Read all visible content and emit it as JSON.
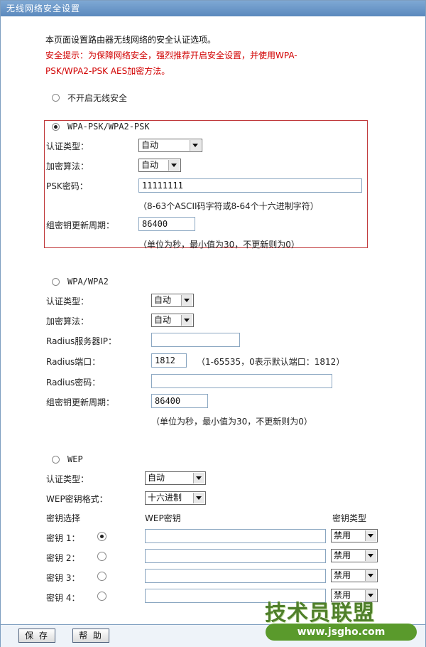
{
  "window": {
    "title": "无线网络安全设置"
  },
  "intro": {
    "line1": "本页面设置路由器无线网络的安全认证选项。",
    "warn_line1": "安全提示：为保障网络安全，强烈推荐开启安全设置，并使用WPA-",
    "warn_line2": "PSK/WPA2-PSK AES加密方法。"
  },
  "no_security": {
    "label": "不开启无线安全",
    "checked": false
  },
  "wpa_psk": {
    "label": "WPA-PSK/WPA2-PSK",
    "checked": true,
    "auth_type_label": "认证类型：",
    "auth_type_value": "自动",
    "encryption_label": "加密算法：",
    "encryption_value": "自动",
    "psk_label": "PSK密码：",
    "psk_value": "11111111",
    "psk_hint": "（8-63个ASCII码字符或8-64个十六进制字符）",
    "group_key_label": "组密钥更新周期：",
    "group_key_value": "86400",
    "group_key_hint": "（单位为秒，最小值为30，不更新则为0）"
  },
  "wpa": {
    "label": "WPA/WPA2",
    "checked": false,
    "auth_type_label": "认证类型：",
    "auth_type_value": "自动",
    "encryption_label": "加密算法：",
    "encryption_value": "自动",
    "radius_ip_label": "Radius服务器IP：",
    "radius_ip_value": "",
    "radius_port_label": "Radius端口：",
    "radius_port_value": "1812",
    "radius_port_hint": "（1-65535，0表示默认端口：1812）",
    "radius_pwd_label": "Radius密码：",
    "radius_pwd_value": "",
    "group_key_label": "组密钥更新周期：",
    "group_key_value": "86400",
    "group_key_hint": "（单位为秒，最小值为30，不更新则为0）"
  },
  "wep": {
    "label": "WEP",
    "checked": false,
    "auth_type_label": "认证类型：",
    "auth_type_value": "自动",
    "key_format_label": "WEP密钥格式：",
    "key_format_value": "十六进制",
    "col_select": "密钥选择",
    "col_key": "WEP密钥",
    "col_type": "密钥类型",
    "keys": [
      {
        "label": "密钥 1：",
        "value": "",
        "type": "禁用",
        "checked": true
      },
      {
        "label": "密钥 2：",
        "value": "",
        "type": "禁用",
        "checked": false
      },
      {
        "label": "密钥 3：",
        "value": "",
        "type": "禁用",
        "checked": false
      },
      {
        "label": "密钥 4：",
        "value": "",
        "type": "禁用",
        "checked": false
      }
    ]
  },
  "buttons": {
    "save": "保 存",
    "help": "帮 助"
  },
  "watermark": {
    "text": "技术员联盟",
    "url": "www.jsgho.com"
  }
}
